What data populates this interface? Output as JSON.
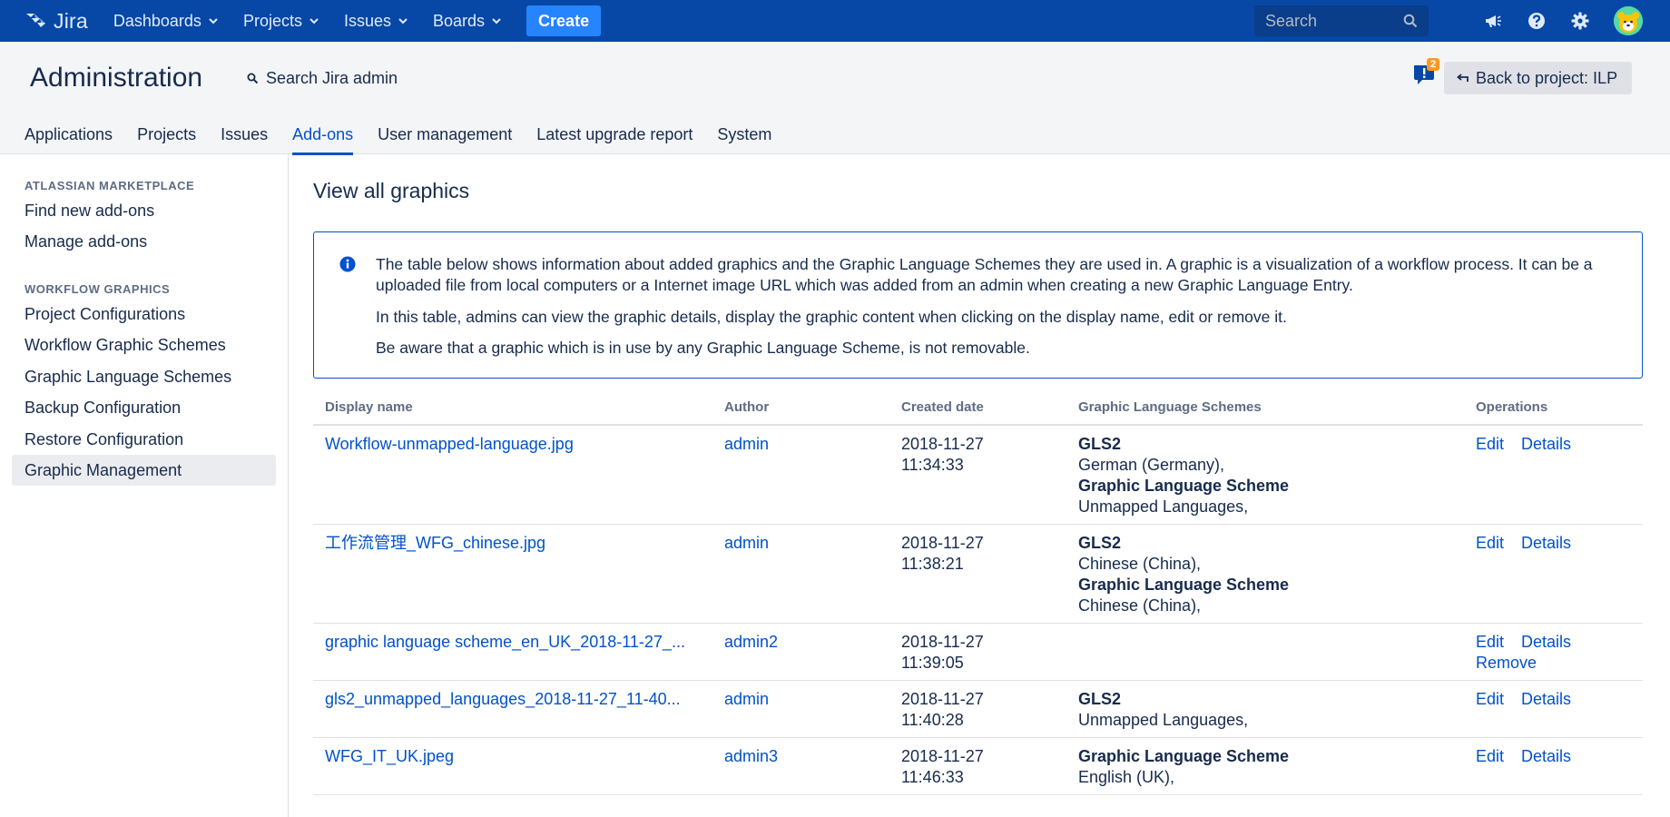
{
  "topnav": {
    "logo_text": "Jira",
    "menus": [
      {
        "label": "Dashboards"
      },
      {
        "label": "Projects"
      },
      {
        "label": "Issues"
      },
      {
        "label": "Boards"
      }
    ],
    "create_label": "Create",
    "search_placeholder": "Search"
  },
  "admin": {
    "title": "Administration",
    "search_label": "Search Jira admin",
    "notification_count": "2",
    "back_label": "Back to project: ILP",
    "tabs": [
      {
        "label": "Applications"
      },
      {
        "label": "Projects"
      },
      {
        "label": "Issues"
      },
      {
        "label": "Add-ons"
      },
      {
        "label": "User management"
      },
      {
        "label": "Latest upgrade report"
      },
      {
        "label": "System"
      }
    ],
    "active_tab": "Add-ons"
  },
  "sidebar": {
    "sections": [
      {
        "heading": "ATLASSIAN MARKETPLACE",
        "items": [
          {
            "label": "Find new add-ons"
          },
          {
            "label": "Manage add-ons"
          }
        ]
      },
      {
        "heading": "WORKFLOW GRAPHICS",
        "items": [
          {
            "label": "Project Configurations"
          },
          {
            "label": "Workflow Graphic Schemes"
          },
          {
            "label": "Graphic Language Schemes"
          },
          {
            "label": "Backup Configuration"
          },
          {
            "label": "Restore Configuration"
          },
          {
            "label": "Graphic Management"
          }
        ]
      }
    ],
    "selected": "Graphic Management"
  },
  "main": {
    "title": "View all graphics",
    "info": [
      "The table below shows information about added graphics and the Graphic Language Schemes they are used in. A graphic is a visualization of a workflow process. It can be a uploaded file from local computers or a Internet image URL which was added from an admin when creating a new Graphic Language Entry.",
      "In this table, admins can view the graphic details, display the graphic content when clicking on the display name, edit or remove it.",
      "Be aware that a graphic which is in use by any Graphic Language Scheme, is not removable."
    ],
    "table": {
      "headers": [
        "Display name",
        "Author",
        "Created date",
        "Graphic Language Schemes",
        "Operations"
      ],
      "rows": [
        {
          "name": "Workflow-unmapped-language.jpg",
          "author": "admin",
          "date": "2018-11-27",
          "time": "11:34:33",
          "schemes": [
            {
              "scheme": "GLS2",
              "language": "German (Germany),"
            },
            {
              "scheme": "Graphic Language Scheme",
              "language": "Unmapped Languages,"
            }
          ],
          "ops": [
            "Edit",
            "Details"
          ]
        },
        {
          "name": "工作流管理_WFG_chinese.jpg",
          "author": "admin",
          "date": "2018-11-27",
          "time": "11:38:21",
          "schemes": [
            {
              "scheme": "GLS2",
              "language": "Chinese (China),"
            },
            {
              "scheme": "Graphic Language Scheme",
              "language": "Chinese (China),"
            }
          ],
          "ops": [
            "Edit",
            "Details"
          ]
        },
        {
          "name": "graphic language scheme_en_UK_2018-11-27_...",
          "author": "admin2",
          "date": "2018-11-27",
          "time": "11:39:05",
          "schemes": [],
          "ops": [
            "Edit",
            "Details",
            "Remove"
          ]
        },
        {
          "name": "gls2_unmapped_languages_2018-11-27_11-40...",
          "author": "admin",
          "date": "2018-11-27",
          "time": "11:40:28",
          "schemes": [
            {
              "scheme": "GLS2",
              "language": "Unmapped Languages,"
            }
          ],
          "ops": [
            "Edit",
            "Details"
          ]
        },
        {
          "name": "WFG_IT_UK.jpeg",
          "author": "admin3",
          "date": "2018-11-27",
          "time": "11:46:33",
          "schemes": [
            {
              "scheme": "Graphic Language Scheme",
              "language": "English (UK),"
            }
          ],
          "ops": [
            "Edit",
            "Details"
          ]
        }
      ]
    }
  },
  "colors": {
    "nav_bg": "#0747a6",
    "create_bg": "#2684ff",
    "link": "#0052cc",
    "text": "#172b4d",
    "subtle": "#5e6c84",
    "badge": "#ff991f"
  }
}
